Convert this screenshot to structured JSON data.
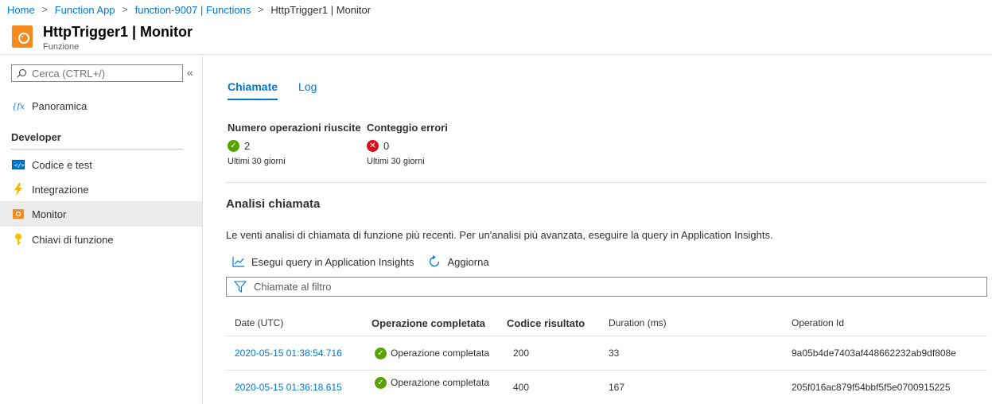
{
  "breadcrumb": [
    {
      "label": "Home"
    },
    {
      "label": "Function App"
    },
    {
      "label": "function-9007 | Functions"
    },
    {
      "label": "HttpTrigger1 | Monitor"
    }
  ],
  "header": {
    "title": "HttpTrigger1 | Monitor",
    "subtitle": "Funzione"
  },
  "sidebar": {
    "search_placeholder": "Cerca (CTRL+/)",
    "collapse_glyph": "«",
    "overview_label": "Panoramica",
    "section": "Developer",
    "items": [
      {
        "label": "Codice e test",
        "icon": "code-icon"
      },
      {
        "label": "Integrazione",
        "icon": "lightning-icon"
      },
      {
        "label": "Monitor",
        "icon": "monitor-icon",
        "selected": true
      },
      {
        "label": "Chiavi di funzione",
        "icon": "key-icon"
      }
    ]
  },
  "tabs": [
    {
      "label": "Chiamate",
      "active": true
    },
    {
      "label": "Log"
    }
  ],
  "metrics": {
    "success": {
      "label": "Numero operazioni riuscite",
      "value": "2",
      "sub": "Ultimi 30 giorni"
    },
    "errors": {
      "label": "Conteggio errori",
      "value": "0",
      "sub": "Ultimi 30 giorni"
    }
  },
  "analysis": {
    "title": "Analisi chiamata",
    "description": "Le venti analisi di chiamata di funzione più recenti. Per un'analisi più avanzata, eseguire la query in Application Insights.",
    "query_button": "Esegui query in Application Insights",
    "refresh_button": "Aggiorna",
    "filter_placeholder": "Chiamate al filtro"
  },
  "table": {
    "headers": [
      "Date (UTC)",
      "Operazione completata",
      "Codice risultato",
      "Duration (ms)",
      "Operation Id"
    ],
    "rows": [
      {
        "date": "2020-05-15 01:38:54.716",
        "status": "Operazione completata",
        "code": "200",
        "duration": "33",
        "id": "9a05b4de7403af448662232ab9df808e"
      },
      {
        "date": "2020-05-15 01:36:18.615",
        "status": "Operazione completata",
        "code": "400",
        "duration": "167",
        "id": "205f016ac879f54bbf5f5e0700915225"
      }
    ]
  },
  "colors": {
    "accent": "#0078d4",
    "success": "#57a300",
    "error": "#e00b1c",
    "brand": "#f58a1f"
  }
}
